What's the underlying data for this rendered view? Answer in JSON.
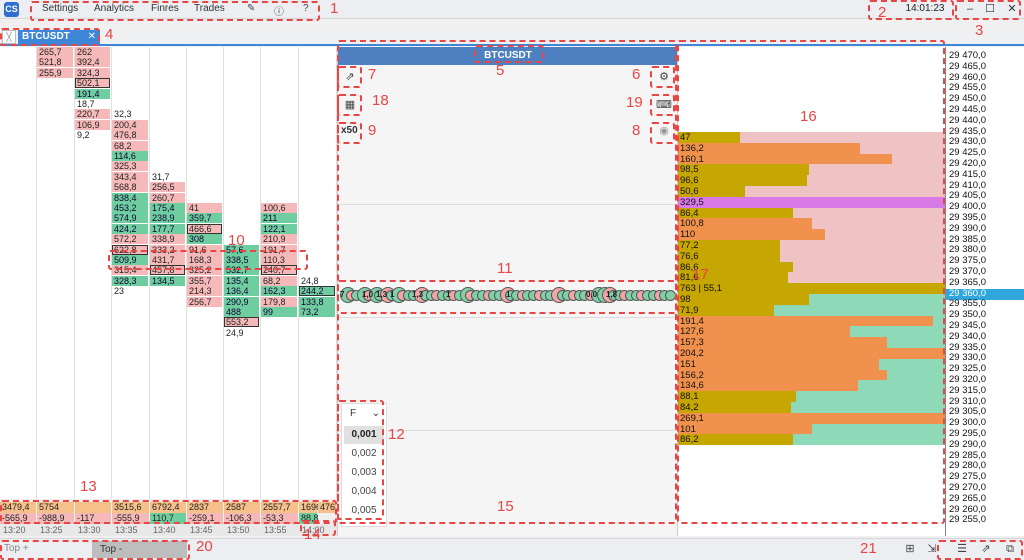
{
  "menu": {
    "items": [
      "Settings",
      "Analytics",
      "Finres",
      "Trades"
    ],
    "clock": "14:01:23"
  },
  "tab": {
    "label": "BTCUSDT"
  },
  "chart": {
    "title": "BTCUSDT",
    "multiplier": "x50",
    "tick_select": "F"
  },
  "tick_options": [
    "0,001",
    "0,002",
    "0,003",
    "0,004",
    "0,005"
  ],
  "bubbles": [
    "7",
    "1,0",
    "1,3",
    "1",
    "1,3",
    "1",
    "1",
    "0,0",
    "1,8"
  ],
  "bottom": {
    "top_plus": "Top +",
    "top_minus": "Top -"
  },
  "annotations": [
    "1",
    "2",
    "3",
    "4",
    "5",
    "6",
    "7",
    "8",
    "9",
    "10",
    "11",
    "12",
    "13",
    "14",
    "15",
    "16",
    "17",
    "18",
    "19",
    "20",
    "21"
  ],
  "cluster_columns": [
    {
      "cells": []
    },
    {
      "cells": [
        {
          "row": 0,
          "v": "265,7",
          "c": "r"
        },
        {
          "row": 1,
          "v": "521,8",
          "c": "r"
        },
        {
          "row": 2,
          "v": "255,9",
          "c": "r"
        }
      ]
    },
    {
      "cells": [
        {
          "row": 0,
          "v": "262",
          "c": "r"
        },
        {
          "row": 1,
          "v": "392,4",
          "c": "r"
        },
        {
          "row": 2,
          "v": "324,3",
          "c": "r"
        },
        {
          "row": 3,
          "v": "502,1",
          "c": "r",
          "b": 1
        },
        {
          "row": 4,
          "v": "191,4",
          "c": "g"
        },
        {
          "row": 5,
          "v": "18,7",
          "c": "n"
        },
        {
          "row": 6,
          "v": "220,7",
          "c": "r"
        },
        {
          "row": 7,
          "v": "106,9",
          "c": "r"
        },
        {
          "row": 8,
          "v": "9,2",
          "c": "n"
        }
      ]
    },
    {
      "cells": [
        {
          "row": 6,
          "v": "32,3",
          "c": "n"
        },
        {
          "row": 7,
          "v": "200,4",
          "c": "r"
        },
        {
          "row": 8,
          "v": "476,8",
          "c": "r"
        },
        {
          "row": 9,
          "v": "68,2",
          "c": "r"
        },
        {
          "row": 10,
          "v": "114,6",
          "c": "g"
        },
        {
          "row": 11,
          "v": "325,3",
          "c": "r"
        },
        {
          "row": 12,
          "v": "343,4",
          "c": "r"
        },
        {
          "row": 13,
          "v": "568,8",
          "c": "r"
        },
        {
          "row": 14,
          "v": "838,4",
          "c": "g"
        },
        {
          "row": 15,
          "v": "453,2",
          "c": "g"
        },
        {
          "row": 16,
          "v": "574,9",
          "c": "g"
        },
        {
          "row": 17,
          "v": "424,2",
          "c": "g"
        },
        {
          "row": 18,
          "v": "572,2",
          "c": "r"
        },
        {
          "row": 19,
          "v": "622,8",
          "c": "r",
          "b": 1
        },
        {
          "row": 20,
          "v": "509,9",
          "c": "g"
        },
        {
          "row": 21,
          "v": "315,4",
          "c": "r"
        },
        {
          "row": 22,
          "v": "328,3",
          "c": "g"
        },
        {
          "row": 23,
          "v": "23",
          "c": "n"
        }
      ]
    },
    {
      "cells": [
        {
          "row": 12,
          "v": "31,7",
          "c": "n"
        },
        {
          "row": 13,
          "v": "256,5",
          "c": "r"
        },
        {
          "row": 14,
          "v": "260,7",
          "c": "r"
        },
        {
          "row": 15,
          "v": "175,4",
          "c": "g"
        },
        {
          "row": 16,
          "v": "238,9",
          "c": "g"
        },
        {
          "row": 17,
          "v": "177,7",
          "c": "g"
        },
        {
          "row": 18,
          "v": "338,9",
          "c": "r"
        },
        {
          "row": 19,
          "v": "333,2",
          "c": "r"
        },
        {
          "row": 20,
          "v": "431,7",
          "c": "r"
        },
        {
          "row": 21,
          "v": "457,8",
          "c": "r",
          "b": 1
        },
        {
          "row": 22,
          "v": "134,5",
          "c": "g"
        }
      ]
    },
    {
      "cells": [
        {
          "row": 15,
          "v": "41",
          "c": "r"
        },
        {
          "row": 16,
          "v": "359,7",
          "c": "g"
        },
        {
          "row": 17,
          "v": "466,6",
          "c": "r",
          "b": 1
        },
        {
          "row": 18,
          "v": "308",
          "c": "g"
        },
        {
          "row": 19,
          "v": "91,6",
          "c": "r"
        },
        {
          "row": 20,
          "v": "168,3",
          "c": "r"
        },
        {
          "row": 21,
          "v": "325,2",
          "c": "r"
        },
        {
          "row": 22,
          "v": "355,7",
          "c": "r"
        },
        {
          "row": 23,
          "v": "214,3",
          "c": "r"
        },
        {
          "row": 24,
          "v": "256,7",
          "c": "r"
        }
      ]
    },
    {
      "cells": [
        {
          "row": 19,
          "v": "57,6",
          "c": "g"
        },
        {
          "row": 20,
          "v": "338,5",
          "c": "g"
        },
        {
          "row": 21,
          "v": "532,7",
          "c": "g"
        },
        {
          "row": 22,
          "v": "135,4",
          "c": "g"
        },
        {
          "row": 23,
          "v": "136,4",
          "c": "g"
        },
        {
          "row": 24,
          "v": "290,9",
          "c": "g"
        },
        {
          "row": 25,
          "v": "488",
          "c": "g"
        },
        {
          "row": 26,
          "v": "553,2",
          "c": "r",
          "b": 1
        },
        {
          "row": 27,
          "v": "24,9",
          "c": "n"
        }
      ]
    },
    {
      "cells": [
        {
          "row": 15,
          "v": "100,6",
          "c": "r"
        },
        {
          "row": 16,
          "v": "211",
          "c": "g"
        },
        {
          "row": 17,
          "v": "122,1",
          "c": "g"
        },
        {
          "row": 18,
          "v": "210,9",
          "c": "r"
        },
        {
          "row": 19,
          "v": "191,7",
          "c": "r"
        },
        {
          "row": 20,
          "v": "110,3",
          "c": "r"
        },
        {
          "row": 21,
          "v": "240,7",
          "c": "r",
          "b": 1
        },
        {
          "row": 22,
          "v": "68,2",
          "c": "r"
        },
        {
          "row": 23,
          "v": "162,3",
          "c": "g"
        },
        {
          "row": 24,
          "v": "179,8",
          "c": "r"
        },
        {
          "row": 25,
          "v": "99",
          "c": "g"
        }
      ]
    },
    {
      "cells": [
        {
          "row": 22,
          "v": "24,8",
          "c": "n"
        },
        {
          "row": 23,
          "v": "244,2",
          "c": "g",
          "b": 1
        },
        {
          "row": 24,
          "v": "133,8",
          "c": "g"
        },
        {
          "row": 25,
          "v": "73,2",
          "c": "g"
        }
      ]
    }
  ],
  "col_sum1": [
    {
      "v": "3479,4",
      "c": "#f5c08a"
    },
    {
      "v": "5754",
      "c": "#f5c08a"
    },
    {
      "v": "",
      "c": "#f5c08a"
    },
    {
      "v": "3515,6",
      "c": "#f5c08a"
    },
    {
      "v": "6792,4",
      "c": "#f5c08a"
    },
    {
      "v": "2837",
      "c": "#f5c08a"
    },
    {
      "v": "2587",
      "c": "#f5c08a"
    },
    {
      "v": "2557,7",
      "c": "#f5c08a"
    },
    {
      "v": "1696,5",
      "c": "#f5c08a"
    },
    {
      "v": "476",
      "c": "#f5c08a"
    }
  ],
  "col_sum2": [
    {
      "v": "-565,9",
      "c": "#f6b9b9"
    },
    {
      "v": "-988,9",
      "c": "#f6b9b9"
    },
    {
      "v": "-117",
      "c": "#f6b9b9"
    },
    {
      "v": "-555,9",
      "c": "#f6b9b9"
    },
    {
      "v": "110,7",
      "c": "#6fce9f"
    },
    {
      "v": "-259,1",
      "c": "#f6b9b9"
    },
    {
      "v": "-106,3",
      "c": "#f6b9b9"
    },
    {
      "v": "-53,3",
      "c": "#f6b9b9"
    },
    {
      "v": "88,8",
      "c": "#6fce9f"
    }
  ],
  "times": [
    "13:20",
    "13:25",
    "13:30",
    "13:35",
    "13:40",
    "13:45",
    "13:50",
    "13:55",
    "14:00"
  ],
  "prices": [
    "29 470,0",
    "29 465,0",
    "29 460,0",
    "29 455,0",
    "29 450,0",
    "29 445,0",
    "29 440,0",
    "29 435,0",
    "29 430,0",
    "29 425,0",
    "29 420,0",
    "29 415,0",
    "29 410,0",
    "29 405,0",
    "29 400,0",
    "29 395,0",
    "29 390,0",
    "29 385,0",
    "29 380,0",
    "29 375,0",
    "29 370,0",
    "29 365,0",
    "29 360,0",
    "29 355,0",
    "29 350,0",
    "29 345,0",
    "29 340,0",
    "29 335,0",
    "29 330,0",
    "29 325,0",
    "29 320,0",
    "29 315,0",
    "29 310,0",
    "29 305,0",
    "29 300,0",
    "29 295,0",
    "29 290,0",
    "29 285,0",
    "29 280,0",
    "29 275,0",
    "29 270,0",
    "29 265,0",
    "29 260,0",
    "29 255,0"
  ],
  "current_price_index": 22,
  "profile": [
    {
      "label": "47",
      "bar": "#c6a600",
      "bw": 0.23,
      "bg": "#efc3c3",
      "bgw": 1.0
    },
    {
      "label": "136,2",
      "bar": "#f0924d",
      "bw": 0.68,
      "bg": "#efc3c3",
      "bgw": 1.0
    },
    {
      "label": "160,1",
      "bar": "#f0924d",
      "bw": 0.8,
      "bg": "#efc3c3",
      "bgw": 1.0
    },
    {
      "label": "98,5",
      "bar": "#c6a600",
      "bw": 0.49,
      "bg": "#efc3c3",
      "bgw": 1.0
    },
    {
      "label": "96,6",
      "bar": "#c6a600",
      "bw": 0.48,
      "bg": "#efc3c3",
      "bgw": 1.0
    },
    {
      "label": "50,6",
      "bar": "#c6a600",
      "bw": 0.25,
      "bg": "#efc3c3",
      "bgw": 1.0
    },
    {
      "label": "329,5",
      "bar": "#d77ae8",
      "bw": 1.0,
      "bg": "#efc3c3",
      "bgw": 1.0
    },
    {
      "label": "86,4",
      "bar": "#c6a600",
      "bw": 0.43,
      "bg": "#efc3c3",
      "bgw": 1.0
    },
    {
      "label": "100,8",
      "bar": "#f0924d",
      "bw": 0.5,
      "bg": "#efc3c3",
      "bgw": 1.0
    },
    {
      "label": "110",
      "bar": "#f0924d",
      "bw": 0.55,
      "bg": "#efc3c3",
      "bgw": 1.0
    },
    {
      "label": "77,2",
      "bar": "#c6a600",
      "bw": 0.38,
      "bg": "#efc3c3",
      "bgw": 1.0
    },
    {
      "label": "76,6",
      "bar": "#c6a600",
      "bw": 0.38,
      "bg": "#efc3c3",
      "bgw": 1.0
    },
    {
      "label": "86,6",
      "bar": "#c6a600",
      "bw": 0.43,
      "bg": "#efc3c3",
      "bgw": 1.0
    },
    {
      "label": "81,6",
      "bar": "#c6a600",
      "bw": 0.41,
      "bg": "#efc3c3",
      "bgw": 1.0
    },
    {
      "label": "763 | 55,1",
      "bar": "#c6a600",
      "bw": 1.0,
      "bg": "#8ed9b8",
      "bgw": 1.0
    },
    {
      "label": "98",
      "bar": "#c6a600",
      "bw": 0.49,
      "bg": "#8ed9b8",
      "bgw": 1.0
    },
    {
      "label": "71,9",
      "bar": "#c6a600",
      "bw": 0.36,
      "bg": "#8ed9b8",
      "bgw": 1.0
    },
    {
      "label": "191,4",
      "bar": "#f0924d",
      "bw": 0.95,
      "bg": "#8ed9b8",
      "bgw": 1.0
    },
    {
      "label": "127,6",
      "bar": "#f0924d",
      "bw": 0.64,
      "bg": "#8ed9b8",
      "bgw": 1.0
    },
    {
      "label": "157,3",
      "bar": "#f0924d",
      "bw": 0.78,
      "bg": "#8ed9b8",
      "bgw": 1.0
    },
    {
      "label": "204,2",
      "bar": "#f0924d",
      "bw": 1.0,
      "bg": "#8ed9b8",
      "bgw": 1.0
    },
    {
      "label": "151",
      "bar": "#f0924d",
      "bw": 0.75,
      "bg": "#8ed9b8",
      "bgw": 1.0
    },
    {
      "label": "156,2",
      "bar": "#f0924d",
      "bw": 0.78,
      "bg": "#8ed9b8",
      "bgw": 1.0
    },
    {
      "label": "134,6",
      "bar": "#f0924d",
      "bw": 0.67,
      "bg": "#8ed9b8",
      "bgw": 1.0
    },
    {
      "label": "88,1",
      "bar": "#c6a600",
      "bw": 0.44,
      "bg": "#8ed9b8",
      "bgw": 1.0
    },
    {
      "label": "84,2",
      "bar": "#c6a600",
      "bw": 0.42,
      "bg": "#8ed9b8",
      "bgw": 1.0
    },
    {
      "label": "269,1",
      "bar": "#f0924d",
      "bw": 1.0,
      "bg": "#8ed9b8",
      "bgw": 1.0
    },
    {
      "label": "101",
      "bar": "#f0924d",
      "bw": 0.5,
      "bg": "#8ed9b8",
      "bgw": 1.0
    },
    {
      "label": "86,2",
      "bar": "#c6a600",
      "bw": 0.43,
      "bg": "#8ed9b8",
      "bgw": 1.0
    }
  ]
}
